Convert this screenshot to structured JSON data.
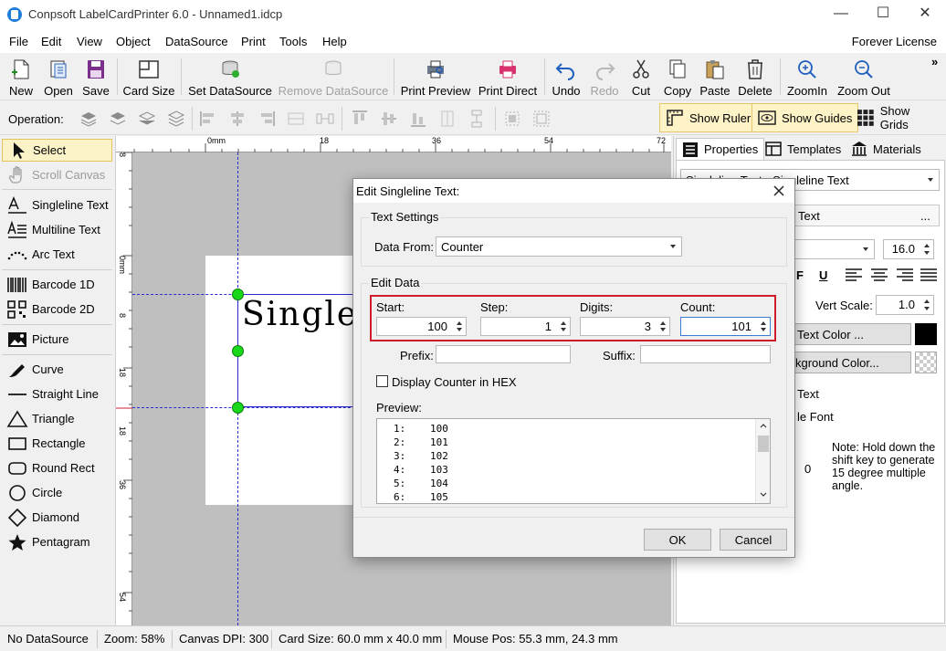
{
  "window": {
    "title": "Conpsoft LabelCardPrinter 6.0 - Unnamed1.idcp",
    "minimize": "—",
    "maximize": "☐",
    "close": "✕"
  },
  "menu": {
    "items": [
      "File",
      "Edit",
      "View",
      "Object",
      "DataSource",
      "Print",
      "Tools",
      "Help"
    ],
    "license": "Forever License"
  },
  "toolbar": {
    "buttons": [
      {
        "label": "New",
        "icon": "new-document-icon",
        "enabled": true
      },
      {
        "label": "Open",
        "icon": "open-icon",
        "enabled": true
      },
      {
        "label": "Save",
        "icon": "save-icon",
        "enabled": true
      },
      {
        "label": "Card Size",
        "icon": "card-size-icon",
        "enabled": true
      },
      {
        "label": "Set DataSource",
        "icon": "set-datasource-icon",
        "enabled": true
      },
      {
        "label": "Remove DataSource",
        "icon": "remove-datasource-icon",
        "enabled": false
      },
      {
        "label": "Print Preview",
        "icon": "print-preview-icon",
        "enabled": true
      },
      {
        "label": "Print Direct",
        "icon": "printer-icon",
        "enabled": true
      },
      {
        "label": "Undo",
        "icon": "undo-icon",
        "enabled": true
      },
      {
        "label": "Redo",
        "icon": "redo-icon",
        "enabled": false
      },
      {
        "label": "Cut",
        "icon": "scissors-icon",
        "enabled": true
      },
      {
        "label": "Copy",
        "icon": "copy-icon",
        "enabled": true
      },
      {
        "label": "Paste",
        "icon": "paste-icon",
        "enabled": true
      },
      {
        "label": "Delete",
        "icon": "trash-icon",
        "enabled": true
      },
      {
        "label": "ZoomIn",
        "icon": "zoom-in-icon",
        "enabled": true
      },
      {
        "label": "Zoom Out",
        "icon": "zoom-out-icon",
        "enabled": true
      }
    ],
    "overflow": "»"
  },
  "operation_bar": {
    "label": "Operation:",
    "show_ruler": "Show Ruler",
    "show_guides": "Show Guides",
    "show_grids": "Show Grids"
  },
  "toolbox": {
    "items": [
      {
        "label": "Select",
        "icon": "cursor-arrow-icon",
        "selected": true
      },
      {
        "label": "Scroll Canvas",
        "icon": "hand-icon",
        "disabled": true
      },
      {
        "label": "Singleline Text",
        "icon": "singleline-text-icon"
      },
      {
        "label": "Multiline Text",
        "icon": "multiline-text-icon"
      },
      {
        "label": "Arc Text",
        "icon": "arc-text-icon"
      },
      {
        "label": "Barcode 1D",
        "icon": "barcode-icon"
      },
      {
        "label": "Barcode 2D",
        "icon": "qr-code-icon"
      },
      {
        "label": "Picture",
        "icon": "picture-icon"
      },
      {
        "label": "Curve",
        "icon": "pen-curve-icon"
      },
      {
        "label": "Straight Line",
        "icon": "line-icon"
      },
      {
        "label": "Triangle",
        "icon": "triangle-icon"
      },
      {
        "label": "Rectangle",
        "icon": "rectangle-icon"
      },
      {
        "label": "Round Rect",
        "icon": "round-rect-icon"
      },
      {
        "label": "Circle",
        "icon": "circle-icon"
      },
      {
        "label": "Diamond",
        "icon": "diamond-icon"
      },
      {
        "label": "Pentagram",
        "icon": "star-icon"
      }
    ]
  },
  "ruler": {
    "top_labels": [
      "0mm",
      "18",
      "36",
      "54",
      "72"
    ],
    "left_labels": [
      "8",
      "0mm",
      "8",
      "18",
      "18",
      "36",
      "54"
    ]
  },
  "canvas": {
    "text": "Single"
  },
  "right_panel": {
    "tabs": [
      "Properties",
      "Templates",
      "Materials"
    ],
    "object_selector": "Singleline Text - Singleline Text",
    "text_field_button": "Text",
    "text_field_more": "...",
    "font_size": "16.0",
    "font_style_buttons": [
      "F",
      "U"
    ],
    "vert_scale_label": "Vert Scale:",
    "vert_scale": "1.0",
    "text_color_button": "Text Color ...",
    "text_color_swatch": "#000000",
    "background_color_button": "kground Color...",
    "text_option": "Text",
    "font_option": "le Font",
    "rotation_value": "0",
    "note": "Note: Hold down the shift key to generate 15 degree multiple angle."
  },
  "dialog": {
    "title": "Edit Singleline Text:",
    "text_settings_group": "Text Settings",
    "data_from_label": "Data From:",
    "data_from_value": "Counter",
    "edit_data_group": "Edit Data",
    "start_label": "Start:",
    "start_value": "100",
    "step_label": "Step:",
    "step_value": "1",
    "digits_label": "Digits:",
    "digits_value": "3",
    "count_label": "Count:",
    "count_value": "101",
    "prefix_label": "Prefix:",
    "prefix_value": "",
    "suffix_label": "Suffix:",
    "suffix_value": "",
    "hex_checkbox_label": "Display Counter in HEX",
    "hex_checked": false,
    "preview_label": "Preview:",
    "preview_rows": [
      {
        "n": "1:",
        "v": "100"
      },
      {
        "n": "2:",
        "v": "101"
      },
      {
        "n": "3:",
        "v": "102"
      },
      {
        "n": "4:",
        "v": "103"
      },
      {
        "n": "5:",
        "v": "104"
      },
      {
        "n": "6:",
        "v": "105"
      }
    ],
    "ok": "OK",
    "cancel": "Cancel"
  },
  "status_bar": {
    "datasource": "No DataSource",
    "zoom": "Zoom: 58%",
    "dpi": "Canvas DPI: 300",
    "card_size": "Card Size: 60.0 mm x 40.0 mm",
    "mouse_pos": "Mouse Pos: 55.3 mm, 24.3 mm"
  }
}
